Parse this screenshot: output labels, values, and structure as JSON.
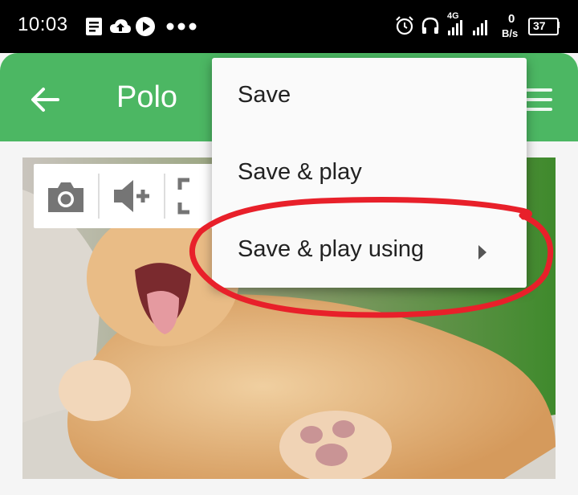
{
  "status_bar": {
    "time": "10:03",
    "network_type": "4G",
    "speed_value": "0",
    "speed_unit": "B/s",
    "battery": "37",
    "icons": [
      "notes-icon",
      "cloud-upload-icon",
      "play-icon",
      "more-dots-icon",
      "alarm-icon",
      "headset-icon",
      "signal-icon",
      "battery-icon"
    ]
  },
  "app_bar": {
    "title": "Polo",
    "accent_color": "#4cb763"
  },
  "image_toolbar": {
    "icons": [
      "camera-icon",
      "volume-add-icon",
      "crop-icon"
    ]
  },
  "menu": {
    "items": [
      {
        "label": "Save"
      },
      {
        "label": "Save & play"
      },
      {
        "label": "Save & play using",
        "has_submenu": true
      }
    ]
  },
  "annotation_color": "#e8202a"
}
